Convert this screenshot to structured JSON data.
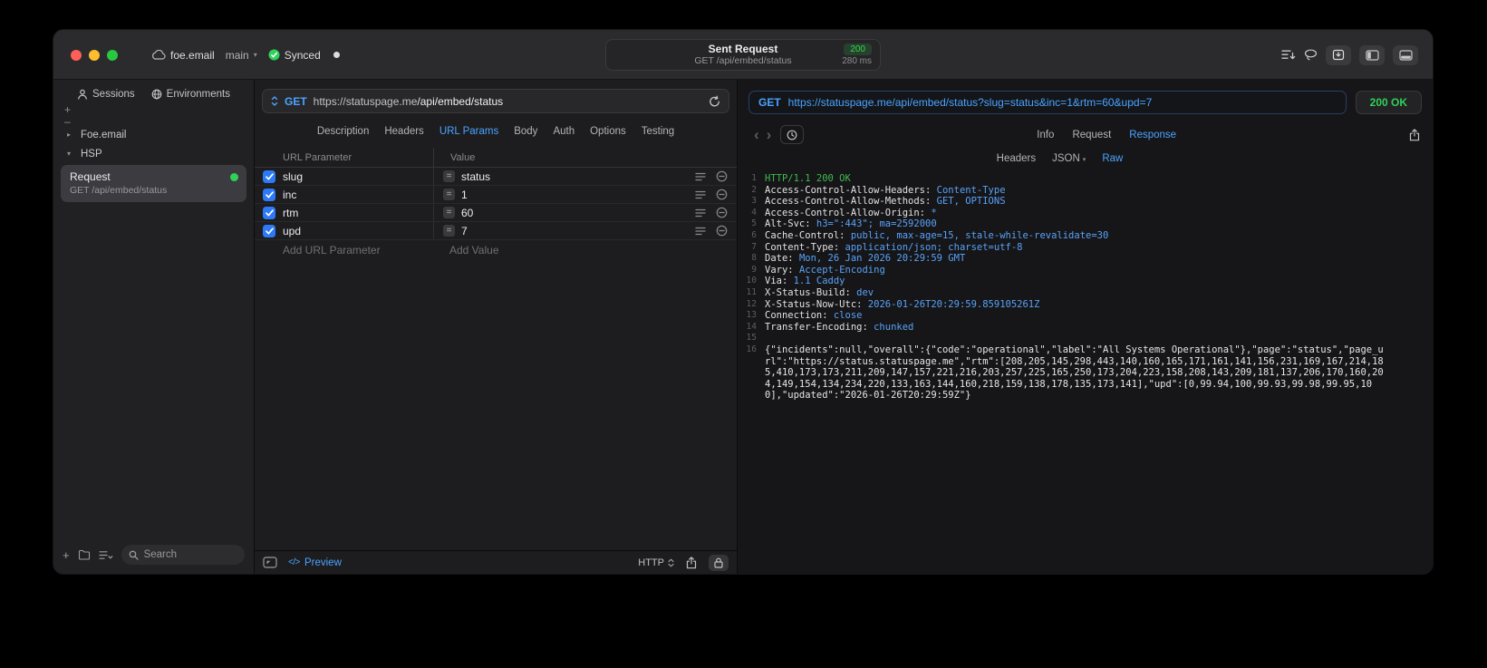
{
  "colors": {
    "accent_blue": "#4ba3ff",
    "status_green": "#30d158"
  },
  "titlebar": {
    "project": "foe.email",
    "branch": "main",
    "synced": "Synced",
    "request_title": "Sent Request",
    "request_status": "200",
    "request_subtitle": "GET /api/embed/status",
    "request_duration": "280 ms"
  },
  "sidebar": {
    "tabs": [
      {
        "label": "Sessions"
      },
      {
        "label": "Environments"
      }
    ],
    "tree": [
      {
        "label": "Foe.email"
      },
      {
        "label": "HSP"
      }
    ],
    "request_item": {
      "title": "Request",
      "subtitle": "GET /api/embed/status"
    },
    "search_placeholder": "Search"
  },
  "request_editor": {
    "method": "GET",
    "url_host": "https://statuspage.me",
    "url_path": "/api/embed/status",
    "tabs": [
      "Description",
      "Headers",
      "URL Params",
      "Body",
      "Auth",
      "Options",
      "Testing"
    ],
    "active_tab": "URL Params",
    "params": {
      "columns": [
        "URL Parameter",
        "Value"
      ],
      "rows": [
        {
          "name": "slug",
          "value": "status",
          "enabled": true
        },
        {
          "name": "inc",
          "value": "1",
          "enabled": true
        },
        {
          "name": "rtm",
          "value": "60",
          "enabled": true
        },
        {
          "name": "upd",
          "value": "7",
          "enabled": true
        }
      ],
      "add_name_placeholder": "Add URL Parameter",
      "add_value_placeholder": "Add Value"
    },
    "footer": {
      "preview": "Preview",
      "protocol": "HTTP"
    }
  },
  "response_viewer": {
    "method": "GET",
    "url": "https://statuspage.me/api/embed/status?slug=status&inc=1&rtm=60&upd=7",
    "status": "200 OK",
    "tabs": [
      "Info",
      "Request",
      "Response"
    ],
    "active_tab": "Response",
    "subtabs": [
      "Headers",
      "JSON",
      "Raw"
    ],
    "active_subtab": "Raw",
    "raw": {
      "status_line": "HTTP/1.1 200 OK",
      "headers": [
        {
          "name": "Access-Control-Allow-Headers",
          "value": "Content-Type"
        },
        {
          "name": "Access-Control-Allow-Methods",
          "value": "GET, OPTIONS"
        },
        {
          "name": "Access-Control-Allow-Origin",
          "value": "*"
        },
        {
          "name": "Alt-Svc",
          "value": "h3=\":443\"; ma=2592000"
        },
        {
          "name": "Cache-Control",
          "value": "public, max-age=15, stale-while-revalidate=30"
        },
        {
          "name": "Content-Type",
          "value": "application/json; charset=utf-8"
        },
        {
          "name": "Date",
          "value": "Mon, 26 Jan 2026 20:29:59 GMT"
        },
        {
          "name": "Vary",
          "value": "Accept-Encoding"
        },
        {
          "name": "Via",
          "value": "1.1 Caddy"
        },
        {
          "name": "X-Status-Build",
          "value": "dev"
        },
        {
          "name": "X-Status-Now-Utc",
          "value": "2026-01-26T20:29:59.859105261Z"
        },
        {
          "name": "Connection",
          "value": "close"
        },
        {
          "name": "Transfer-Encoding",
          "value": "chunked"
        }
      ],
      "body": "{\"incidents\":null,\"overall\":{\"code\":\"operational\",\"label\":\"All Systems Operational\"},\"page\":\"status\",\"page_url\":\"https://status.statuspage.me\",\"rtm\":[208,205,145,298,443,140,160,165,171,161,141,156,231,169,167,214,185,410,173,173,211,209,147,157,221,216,203,257,225,165,250,173,204,223,158,208,143,209,181,137,206,170,160,204,149,154,134,234,220,133,163,144,160,218,159,138,178,135,173,141],\"upd\":[0,99.94,100,99.93,99.98,99.95,100],\"updated\":\"2026-01-26T20:29:59Z\"}"
    }
  }
}
